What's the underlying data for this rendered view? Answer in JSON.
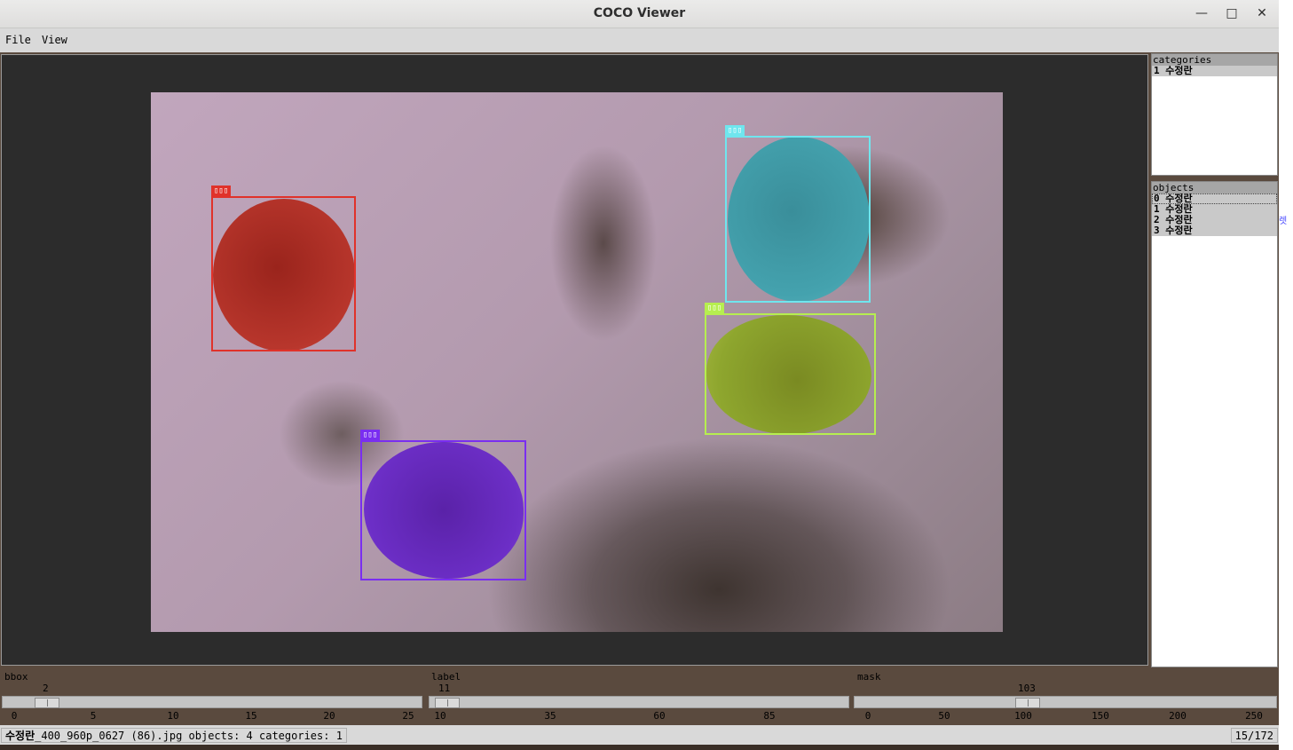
{
  "window": {
    "title": "COCO Viewer",
    "minimize": "—",
    "maximize": "□",
    "close": "✕"
  },
  "side_glyph": "렛",
  "menu": [
    {
      "label": "File"
    },
    {
      "label": "View"
    }
  ],
  "image": {
    "annotations": [
      {
        "id": 0,
        "color": "#e0322a",
        "fill": "#b0302a"
      },
      {
        "id": 1,
        "color": "#6fe6ee",
        "fill": "#3a9ba8"
      },
      {
        "id": 2,
        "color": "#b6ee4f",
        "fill": "#8aa22a"
      },
      {
        "id": 3,
        "color": "#7a2ef0",
        "fill": "#6a2ac2"
      }
    ]
  },
  "categories": {
    "title": "categories",
    "items": [
      {
        "label": "1 수정란"
      }
    ]
  },
  "objects": {
    "title": "objects",
    "items": [
      {
        "label": "0 수정란"
      },
      {
        "label": "1 수정란"
      },
      {
        "label": "2 수정란"
      },
      {
        "label": "3 수정란"
      }
    ]
  },
  "sliders": {
    "bbox": {
      "label": "bbox",
      "value": "2",
      "ticks": [
        "0",
        "5",
        "10",
        "15",
        "20",
        "25"
      ]
    },
    "label": {
      "label": "label",
      "value": "11",
      "ticks": [
        "10",
        "35",
        "60",
        "85"
      ]
    },
    "mask": {
      "label": "mask",
      "value": "103",
      "ticks": [
        "0",
        "50",
        "100",
        "150",
        "200",
        "250"
      ]
    }
  },
  "status": {
    "file_prefix": "수정란",
    "file_rest": "_400_960p_0627 (86).jpg",
    "info": "objects: 4 categories: 1",
    "page": "15/172"
  }
}
